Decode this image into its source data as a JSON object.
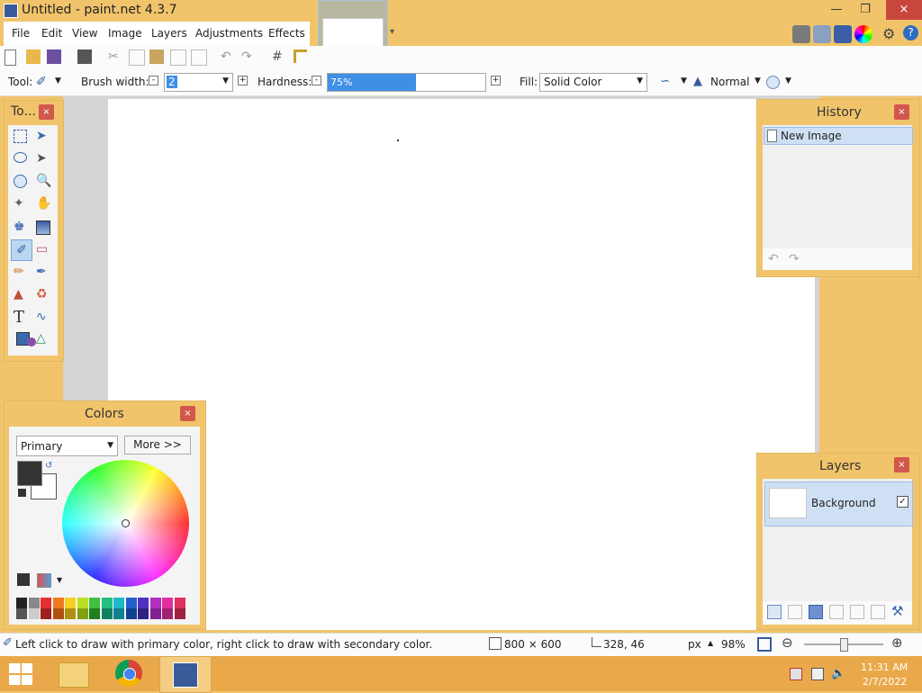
{
  "window": {
    "title": "Untitled - paint.net 4.3.7",
    "restore_icon": "restore-icon",
    "minimize_icon": "minimize-icon",
    "close_label": "×"
  },
  "menu": {
    "items": [
      "File",
      "Edit",
      "View",
      "Image",
      "Layers",
      "Adjustments",
      "Effects"
    ]
  },
  "toolbar": {
    "tool_label": "Tool:",
    "brush_width_label": "Brush width:",
    "brush_width_value": "2",
    "hardness_label": "Hardness:",
    "hardness_value": "75%",
    "hardness_fraction": 0.75,
    "fill_label": "Fill:",
    "fill_value": "Solid Color",
    "blend_mode": "Normal"
  },
  "tools_panel": {
    "title": "To...",
    "close": "×"
  },
  "history_panel": {
    "title": "History",
    "close": "×",
    "items": [
      "New Image"
    ]
  },
  "colors_panel": {
    "title": "Colors",
    "close": "×",
    "mode": "Primary",
    "more_button": "More >>",
    "primary_color": "#333333",
    "secondary_color": "#ffffff"
  },
  "layers_panel": {
    "title": "Layers",
    "close": "×",
    "layers": [
      {
        "name": "Background",
        "visible": true
      }
    ]
  },
  "statusbar": {
    "hint": "Left click to draw with primary color, right click to draw with secondary color.",
    "image_size": "800 × 600",
    "cursor_pos": "328, 46",
    "units": "px",
    "zoom": "98%"
  },
  "taskbar": {
    "time": "11:31 AM",
    "date": "2/7/2022"
  },
  "colors": {
    "accent": "#f1c46b",
    "close_red": "#c9463d",
    "selection_blue": "#3e8fe6"
  }
}
